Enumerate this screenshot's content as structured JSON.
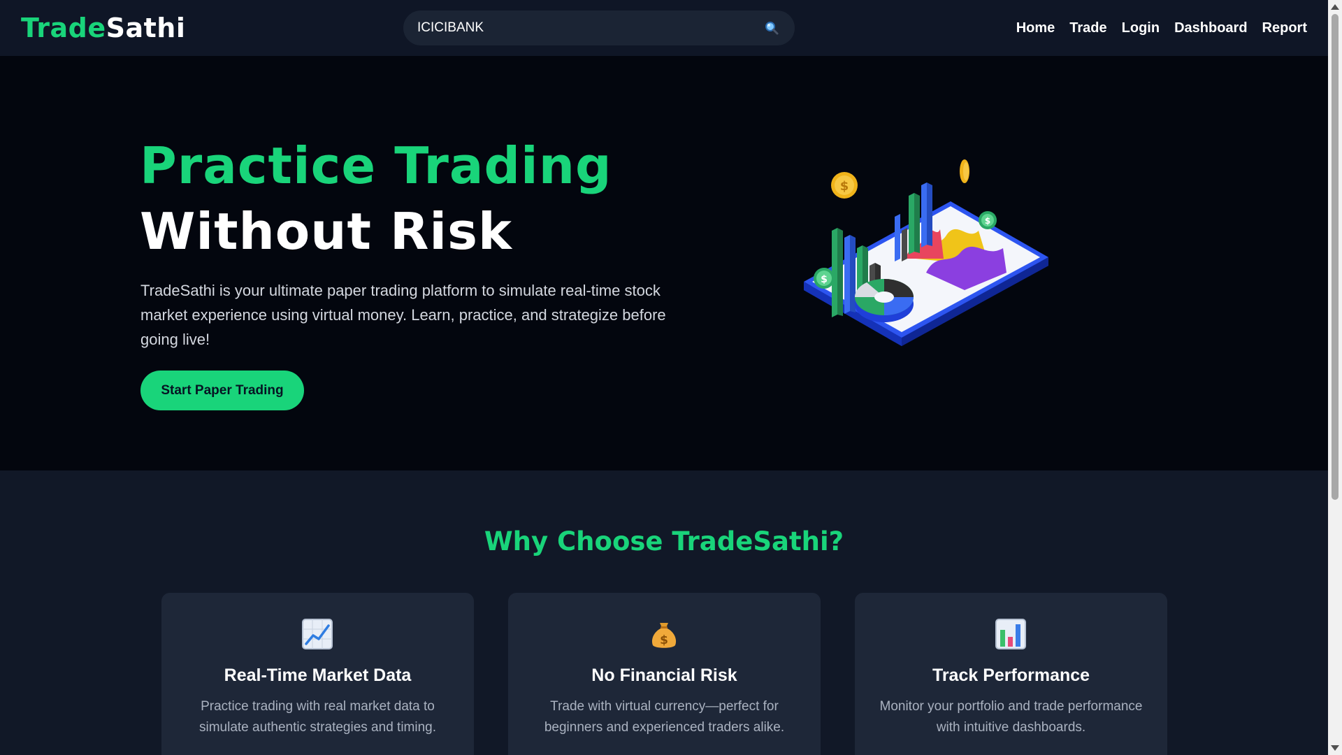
{
  "header": {
    "logo_part1": "Trade",
    "logo_part2": "Sathi",
    "search_value": "ICICIBANK",
    "nav": [
      "Home",
      "Trade",
      "Login",
      "Dashboard",
      "Report"
    ]
  },
  "hero": {
    "title_line1": "Practice Trading",
    "title_line2": "Without Risk",
    "description": "TradeSathi is your ultimate paper trading platform to simulate real-time stock market experience using virtual money. Learn, practice, and strategize before going live!",
    "cta_label": "Start Paper Trading"
  },
  "features": {
    "heading": "Why Choose TradeSathi?",
    "cards": [
      {
        "icon": "chart-increasing-icon",
        "title": "Real-Time Market Data",
        "text": "Practice trading with real market data to simulate authentic strategies and timing."
      },
      {
        "icon": "money-bag-icon",
        "title": "No Financial Risk",
        "text": "Trade with virtual currency—perfect for beginners and experienced traders alike."
      },
      {
        "icon": "bar-chart-icon",
        "title": "Track Performance",
        "text": "Monitor your portfolio and trade performance with intuitive dashboards."
      }
    ]
  },
  "colors": {
    "accent": "#19d47a",
    "header_bg": "#0f1626",
    "hero_bg": "#03060e",
    "features_bg": "#111827",
    "card_bg": "#1e2738"
  }
}
